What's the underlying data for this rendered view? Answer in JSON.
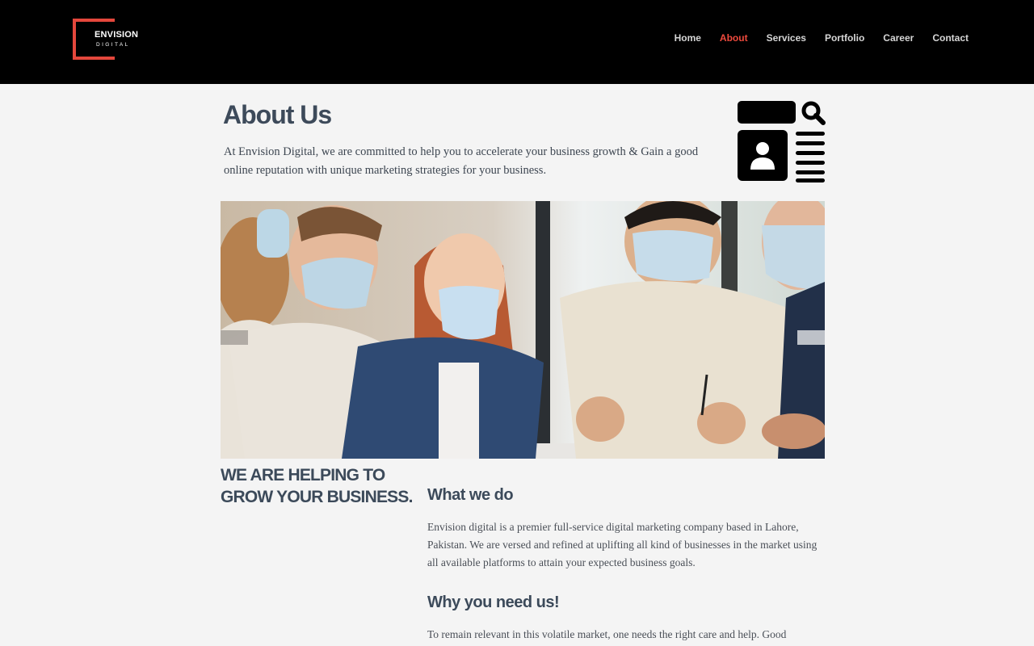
{
  "brand": {
    "name_line1": "ENVISION",
    "name_line2": "DIGITAL",
    "accent_color": "#e4473c"
  },
  "nav": {
    "items": [
      {
        "label": "Home",
        "active": false
      },
      {
        "label": "About",
        "active": true
      },
      {
        "label": "Services",
        "active": false
      },
      {
        "label": "Portfolio",
        "active": false
      },
      {
        "label": "Career",
        "active": false
      },
      {
        "label": "Contact",
        "active": false
      }
    ],
    "active_color": "#ef4a3d"
  },
  "about": {
    "title": "About Us",
    "intro": "At Envision Digital, we are committed to help you to accelerate your business growth & Gain a good online reputation with unique marketing strategies for your business.",
    "icon": "news-search-icon"
  },
  "hero": {
    "image": "team-meeting-photo"
  },
  "tagline": "WE ARE HELPING TO GROW YOUR BUSINESS.",
  "sections": {
    "what_title": "What we do",
    "what_text": "Envision digital is a premier full-service digital marketing company based in Lahore, Pakistan. We are versed and refined at uplifting all kind of businesses in the market using all available platforms to attain your expected business goals.",
    "why_title": "Why you need us!",
    "why_text": "To remain relevant in this volatile market, one needs the right care and help. Good"
  }
}
